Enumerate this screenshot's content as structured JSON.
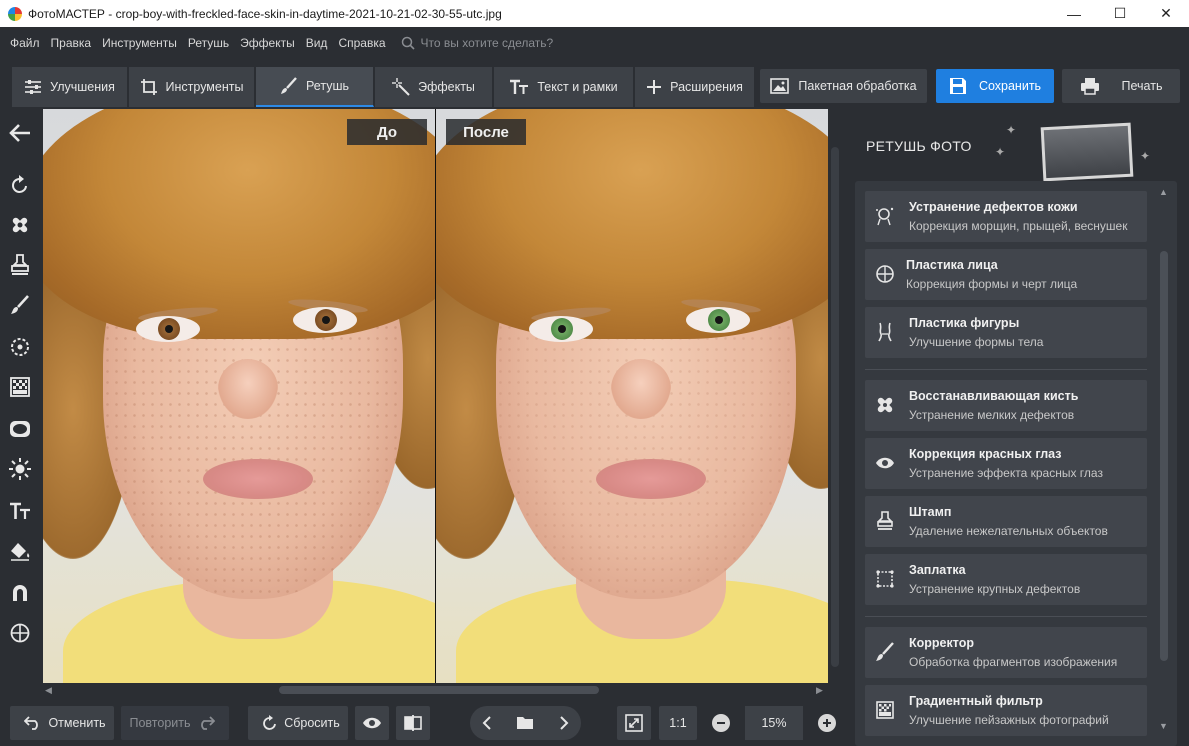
{
  "window": {
    "title": "ФотоМАСТЕР - crop-boy-with-freckled-face-skin-in-daytime-2021-10-21-02-30-55-utc.jpg",
    "minimize": "—",
    "maximize": "☐",
    "close": "✕"
  },
  "menu": {
    "items": [
      "Файл",
      "Правка",
      "Инструменты",
      "Ретушь",
      "Эффекты",
      "Вид",
      "Справка"
    ],
    "search_placeholder": "Что вы хотите сделать?"
  },
  "toolbar": {
    "tabs": [
      {
        "label": "Улучшения",
        "icon": "sliders-icon"
      },
      {
        "label": "Инструменты",
        "icon": "crop-icon"
      },
      {
        "label": "Ретушь",
        "icon": "brush-icon",
        "active": true
      },
      {
        "label": "Эффекты",
        "icon": "magic-wand-icon"
      },
      {
        "label": "Текст и рамки",
        "icon": "text-icon"
      },
      {
        "label": "Расширения",
        "icon": "plus-icon"
      }
    ],
    "batch_label": "Пакетная обработка",
    "save_label": "Сохранить",
    "print_label": "Печать"
  },
  "canvas": {
    "before_label": "До",
    "after_label": "После"
  },
  "bottom": {
    "undo_label": "Отменить",
    "redo_label": "Повторить",
    "reset_label": "Сбросить",
    "ratio_label": "1:1",
    "zoom_value": "15%"
  },
  "panel": {
    "title": "РЕТУШЬ ФОТО",
    "items": [
      {
        "title": "Устранение дефектов кожи",
        "subtitle": "Коррекция морщин, прыщей, веснушек",
        "icon": "face-retouch-icon"
      },
      {
        "title": "Пластика лица",
        "subtitle": "Коррекция формы и черт лица",
        "icon": "face-plastic-icon"
      },
      {
        "title": "Пластика фигуры",
        "subtitle": "Улучшение формы тела",
        "icon": "figure-icon"
      },
      {
        "title": "Восстанавливающая кисть",
        "subtitle": "Устранение мелких дефектов",
        "icon": "bandage-icon"
      },
      {
        "title": "Коррекция красных глаз",
        "subtitle": "Устранение эффекта красных глаз",
        "icon": "eye-icon"
      },
      {
        "title": "Штамп",
        "subtitle": "Удаление нежелательных объектов",
        "icon": "stamp-icon"
      },
      {
        "title": "Заплатка",
        "subtitle": "Устранение крупных дефектов",
        "icon": "patch-icon"
      },
      {
        "title": "Корректор",
        "subtitle": "Обработка фрагментов изображения",
        "icon": "corrector-brush-icon"
      },
      {
        "title": "Градиентный фильтр",
        "subtitle": "Улучшение пейзажных фотографий",
        "icon": "gradient-icon"
      }
    ]
  },
  "colors": {
    "accent": "#1f7fe0",
    "eye_before": "#7a4a22",
    "eye_after": "#4f8a48"
  }
}
